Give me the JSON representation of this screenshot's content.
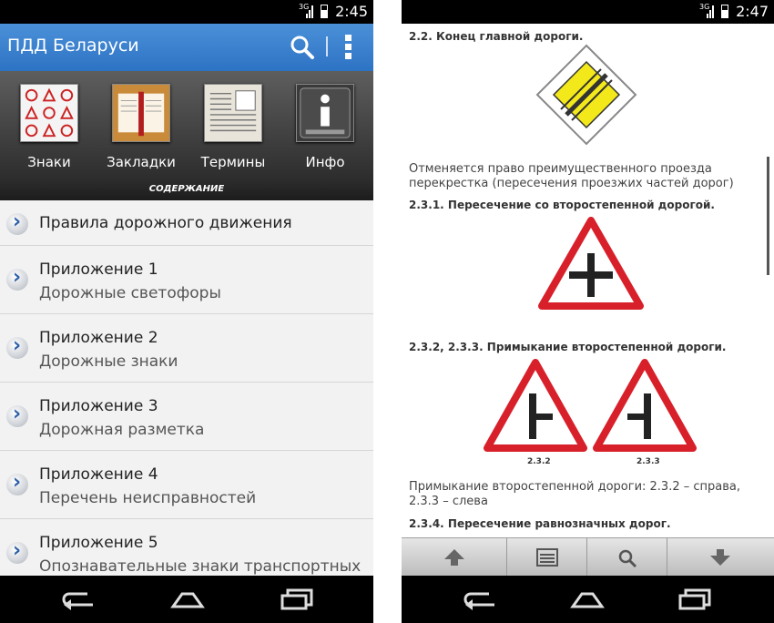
{
  "left": {
    "status_time": "2:45",
    "status_net": "3G",
    "app_title": "ПДД Беларуси",
    "tiles": [
      {
        "label": "Знаки"
      },
      {
        "label": "Закладки"
      },
      {
        "label": "Термины"
      },
      {
        "label": "Инфо"
      }
    ],
    "section_caption": "СОДЕРЖАНИЕ",
    "items": [
      {
        "line1": "Правила дорожного движения",
        "line2": ""
      },
      {
        "line1": "Приложение 1",
        "line2": "Дорожные светофоры"
      },
      {
        "line1": "Приложение 2",
        "line2": "Дорожные знаки"
      },
      {
        "line1": "Приложение 3",
        "line2": "Дорожная разметка"
      },
      {
        "line1": "Приложение 4",
        "line2": "Перечень неисправностей"
      },
      {
        "line1": "Приложение 5",
        "line2": "Опознавательные знаки транспортных"
      }
    ]
  },
  "right": {
    "status_time": "2:47",
    "status_net": "3G",
    "heading_1": "2.2. Конец главной дороги.",
    "para_1": "Отменяется право преимущественного проезда перекрестка (пересечения проезжих частей дорог)",
    "heading_2": "2.3.1. Пересечение со второстепенной дорогой.",
    "heading_3": "2.3.2, 2.3.3. Примыкание второстепенной дороги.",
    "caption_a": "2.3.2",
    "caption_b": "2.3.3",
    "para_2": "Примыкание второстепенной дороги: 2.3.2 – справа, 2.3.3 – слева",
    "heading_4": "2.3.4. Пересечение равнозначных дорог."
  },
  "colors": {
    "appbar": "#3a82d0",
    "sign_red": "#d8202a",
    "sign_yellow": "#f2e81a"
  }
}
